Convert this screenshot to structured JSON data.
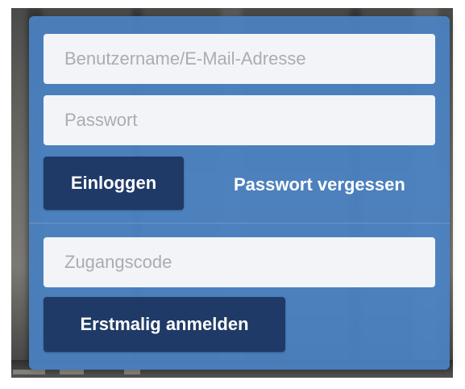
{
  "login_form": {
    "username_placeholder": "Benutzername/E-Mail-Adresse",
    "username_value": "",
    "password_placeholder": "Passwort",
    "password_value": "",
    "login_button_label": "Einloggen",
    "forgot_password_label": "Passwort vergessen"
  },
  "registration_form": {
    "access_code_placeholder": "Zugangscode",
    "access_code_value": "",
    "register_button_label": "Erstmalig anmelden"
  },
  "colors": {
    "panel_background": "#4982c4",
    "button_background": "#1f3a66",
    "input_background": "#f2f4f7",
    "link_text": "#ffffff"
  }
}
